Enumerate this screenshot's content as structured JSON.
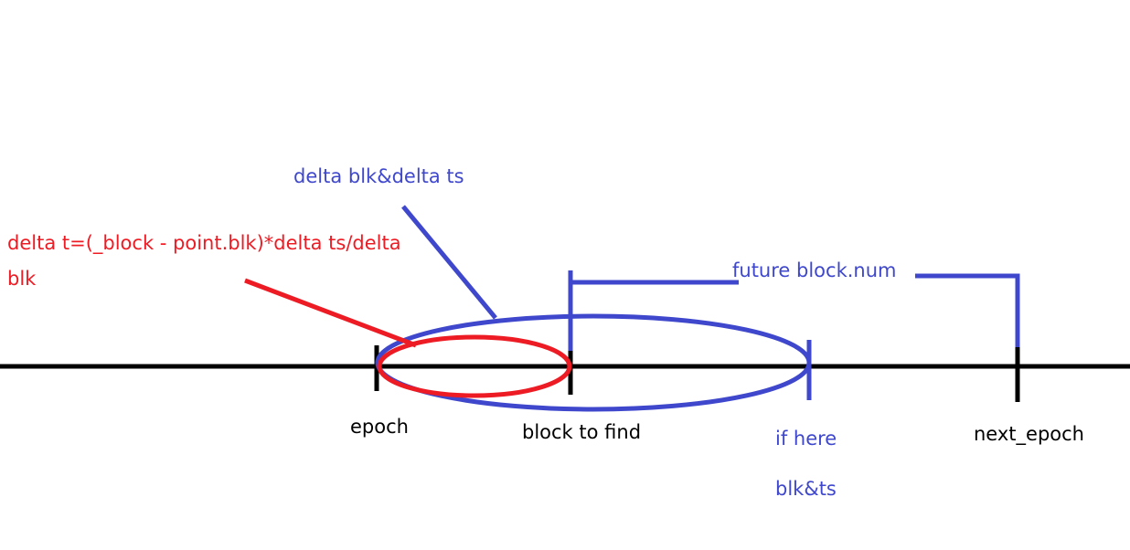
{
  "colors": {
    "axis": "#000000",
    "blue": "#3f48cc",
    "red": "#ed1c24",
    "background": "#ffffff"
  },
  "labels": {
    "epoch": "epoch",
    "block_to_find": "block to find",
    "next_epoch": "next_epoch",
    "if_here_line1": "if here",
    "if_here_line2": "blk&ts",
    "future_block_num": "future block.num",
    "delta_blk_ts": "delta blk&delta ts",
    "formula_line1": "delta t=(_block - point.blk)*delta ts/delta",
    "formula_line2": "blk"
  }
}
